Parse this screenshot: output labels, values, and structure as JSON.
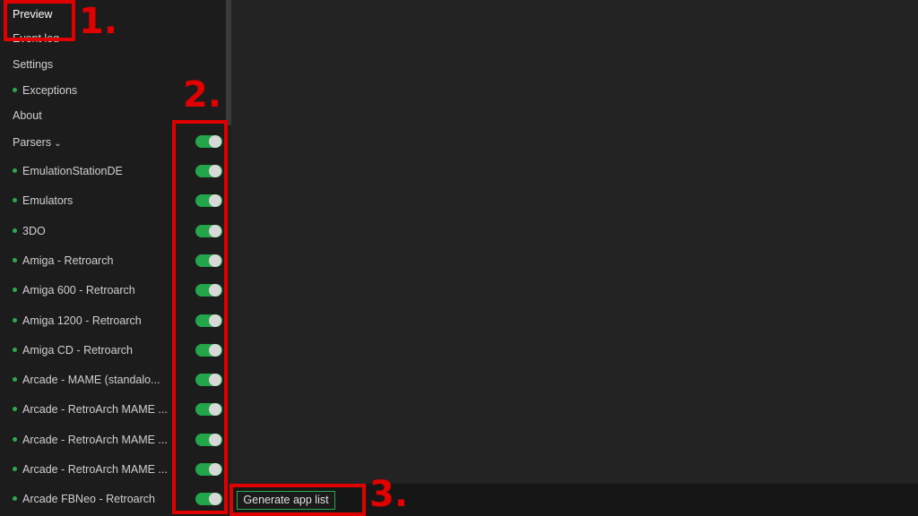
{
  "nav": {
    "preview": "Preview",
    "event_log": "Event log",
    "settings": "Settings",
    "exceptions": "Exceptions",
    "about": "About",
    "parsers": "Parsers"
  },
  "parsers": [
    {
      "label": "EmulationStationDE",
      "enabled": true
    },
    {
      "label": "Emulators",
      "enabled": true
    },
    {
      "label": "3DO",
      "enabled": true
    },
    {
      "label": "Amiga - Retroarch",
      "enabled": true
    },
    {
      "label": "Amiga 600 - Retroarch",
      "enabled": true
    },
    {
      "label": "Amiga 1200 - Retroarch",
      "enabled": true
    },
    {
      "label": "Amiga CD - Retroarch",
      "enabled": true
    },
    {
      "label": "Arcade - MAME (standalo...",
      "enabled": true
    },
    {
      "label": "Arcade - RetroArch MAME ...",
      "enabled": true
    },
    {
      "label": "Arcade - RetroArch MAME ...",
      "enabled": true
    },
    {
      "label": "Arcade - RetroArch MAME ...",
      "enabled": true
    },
    {
      "label": "Arcade FBNeo - Retroarch",
      "enabled": true
    }
  ],
  "bottom": {
    "generate_label": "Generate app list"
  },
  "annotations": {
    "one": "1.",
    "two": "2.",
    "three": "3."
  },
  "colors": {
    "accent_green": "#23a54a",
    "annotation_red": "#e00000"
  }
}
